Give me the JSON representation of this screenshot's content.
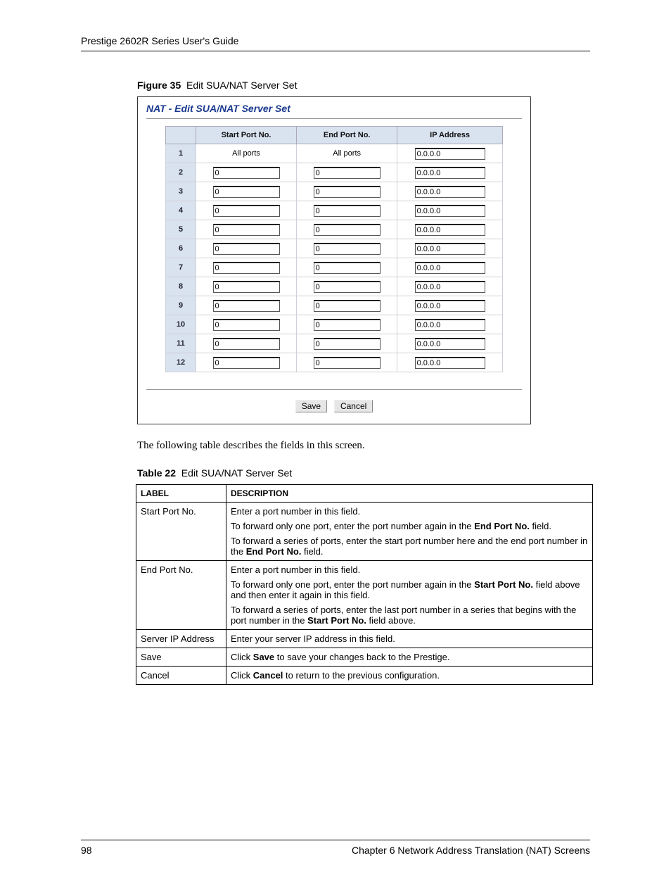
{
  "header": {
    "title": "Prestige 2602R Series User's Guide"
  },
  "figure": {
    "label": "Figure 35",
    "title": "Edit SUA/NAT Server Set"
  },
  "screenshot": {
    "panel_title": "NAT - Edit SUA/NAT Server Set",
    "columns": {
      "c0": "",
      "c1": "Start Port No.",
      "c2": "End Port No.",
      "c3": "IP Address"
    },
    "rows": [
      {
        "idx": "1",
        "start": "All ports",
        "end": "All ports",
        "ip": "0.0.0.0",
        "static": true
      },
      {
        "idx": "2",
        "start": "0",
        "end": "0",
        "ip": "0.0.0.0"
      },
      {
        "idx": "3",
        "start": "0",
        "end": "0",
        "ip": "0.0.0.0"
      },
      {
        "idx": "4",
        "start": "0",
        "end": "0",
        "ip": "0.0.0.0"
      },
      {
        "idx": "5",
        "start": "0",
        "end": "0",
        "ip": "0.0.0.0"
      },
      {
        "idx": "6",
        "start": "0",
        "end": "0",
        "ip": "0.0.0.0"
      },
      {
        "idx": "7",
        "start": "0",
        "end": "0",
        "ip": "0.0.0.0"
      },
      {
        "idx": "8",
        "start": "0",
        "end": "0",
        "ip": "0.0.0.0"
      },
      {
        "idx": "9",
        "start": "0",
        "end": "0",
        "ip": "0.0.0.0"
      },
      {
        "idx": "10",
        "start": "0",
        "end": "0",
        "ip": "0.0.0.0"
      },
      {
        "idx": "11",
        "start": "0",
        "end": "0",
        "ip": "0.0.0.0"
      },
      {
        "idx": "12",
        "start": "0",
        "end": "0",
        "ip": "0.0.0.0"
      }
    ],
    "buttons": {
      "save": "Save",
      "cancel": "Cancel"
    }
  },
  "intro_text": "The following table describes the fields in this screen.",
  "table": {
    "label": "Table 22",
    "title": "Edit SUA/NAT Server Set",
    "headers": {
      "label": "LABEL",
      "description": "DESCRIPTION"
    },
    "rows": [
      {
        "label": "Start Port No.",
        "desc": [
          [
            {
              "t": "Enter a port number in this field."
            }
          ],
          [
            {
              "t": "To forward only one port, enter the port number again in the "
            },
            {
              "t": "End Port No.",
              "b": true
            },
            {
              "t": " field."
            }
          ],
          [
            {
              "t": "To forward a series of ports, enter the start port number here and the end port number in the "
            },
            {
              "t": "End Port No.",
              "b": true
            },
            {
              "t": " field."
            }
          ]
        ]
      },
      {
        "label": "End Port No.",
        "desc": [
          [
            {
              "t": "Enter a port number in this field."
            }
          ],
          [
            {
              "t": "To forward only one port, enter the port number again in the "
            },
            {
              "t": "Start Port No.",
              "b": true
            },
            {
              "t": " field above and then enter it again in this field."
            }
          ],
          [
            {
              "t": "To forward a series of ports, enter the last port number in a series that begins with the port number in the "
            },
            {
              "t": "Start Port No.",
              "b": true
            },
            {
              "t": " field above."
            }
          ]
        ]
      },
      {
        "label": "Server IP Address",
        "desc": [
          [
            {
              "t": "Enter your server IP address in this field."
            }
          ]
        ]
      },
      {
        "label": "Save",
        "desc": [
          [
            {
              "t": "Click "
            },
            {
              "t": "Save",
              "b": true
            },
            {
              "t": " to save your changes back to the Prestige."
            }
          ]
        ]
      },
      {
        "label": "Cancel",
        "desc": [
          [
            {
              "t": "Click "
            },
            {
              "t": "Cancel",
              "b": true
            },
            {
              "t": " to return to the previous configuration."
            }
          ]
        ]
      }
    ]
  },
  "footer": {
    "page": "98",
    "chapter": "Chapter 6 Network Address Translation (NAT) Screens"
  }
}
